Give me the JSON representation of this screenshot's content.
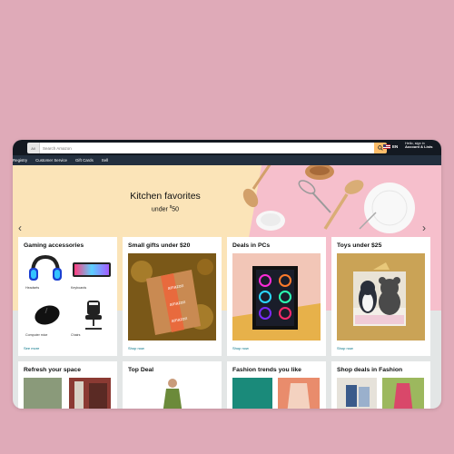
{
  "header": {
    "search_category": "All",
    "search_placeholder": "Search Amazon",
    "language": "EN",
    "account_line1": "Hello, sign in",
    "account_line2": "Account & Lists"
  },
  "subnav": [
    "Registry",
    "Customer Service",
    "Gift Cards",
    "Sell"
  ],
  "hero": {
    "title": "Kitchen favorites",
    "subtitle_prefix": "under ",
    "subtitle_currency": "$",
    "subtitle_value": "50"
  },
  "cards": [
    {
      "title": "Gaming accessories",
      "link": "See more",
      "items": [
        "Headsets",
        "Keyboards",
        "Computer mice",
        "Chairs"
      ]
    },
    {
      "title": "Small gifts under $20",
      "link": "Shop now"
    },
    {
      "title": "Deals in PCs",
      "link": "Shop now"
    },
    {
      "title": "Toys under $25",
      "link": "Shop now"
    },
    {
      "title": "Refresh your space"
    },
    {
      "title": "Top Deal"
    },
    {
      "title": "Fashion trends you like"
    },
    {
      "title": "Shop deals in Fashion"
    }
  ],
  "colors": {
    "nav_dark": "#131921",
    "nav_sub": "#232f3e",
    "search_button": "#febd69",
    "link": "#007185",
    "hero_left": "#fbe4b8",
    "hero_right": "#f6bfcc",
    "background": "#dfaab8"
  }
}
